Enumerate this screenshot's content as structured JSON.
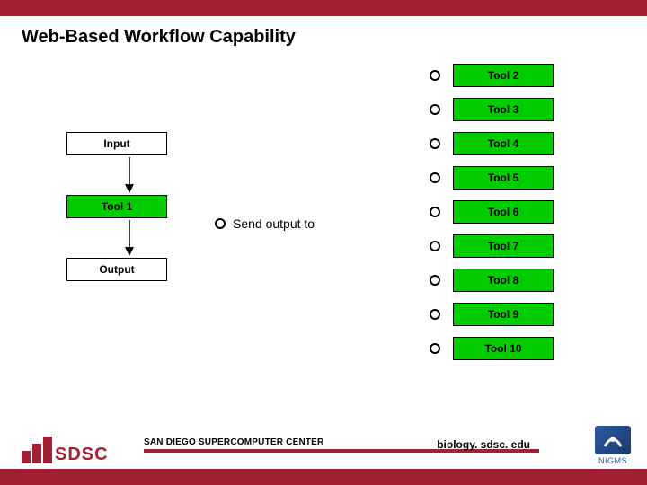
{
  "title": "Web-Based Workflow Capability",
  "left": {
    "input": "Input",
    "tool1": "Tool 1",
    "output": "Output"
  },
  "mid": {
    "send_label": "Send output to"
  },
  "tools": [
    {
      "label": "Tool 2"
    },
    {
      "label": "Tool 3"
    },
    {
      "label": "Tool 4"
    },
    {
      "label": "Tool 5"
    },
    {
      "label": "Tool 6"
    },
    {
      "label": "Tool 7"
    },
    {
      "label": "Tool 8"
    },
    {
      "label": "Tool 9"
    },
    {
      "label": "Tool 10"
    }
  ],
  "footer": {
    "center": "SAN DIEGO SUPERCOMPUTER CENTER",
    "url": "biology. sdsc. edu",
    "sdsc": "SDSC",
    "nigms": "NIGMS"
  }
}
